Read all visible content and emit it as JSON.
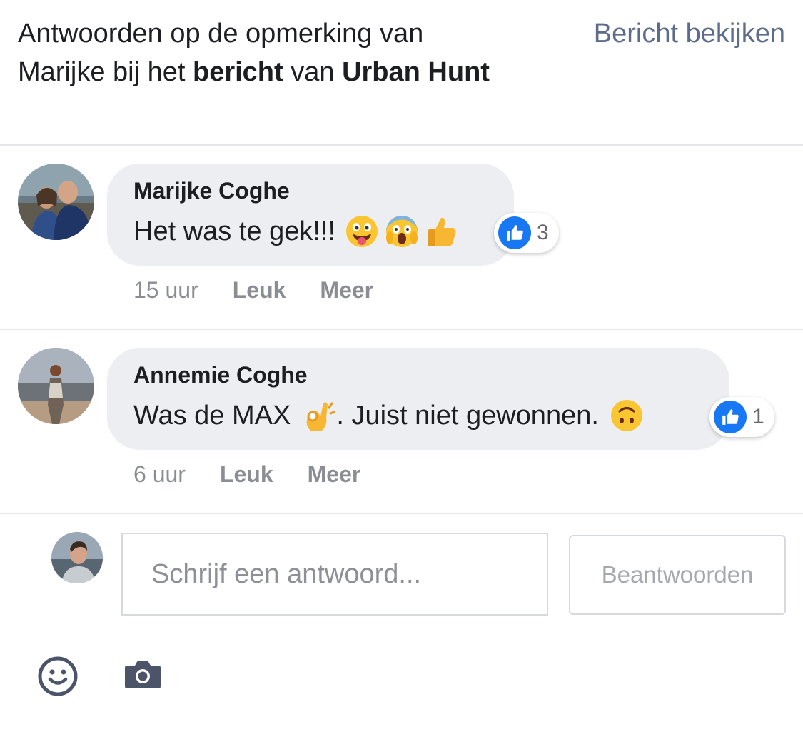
{
  "header": {
    "title_part1": "Antwoorden op de opmerking van Marijke bij het ",
    "title_bold1": "bericht",
    "title_part2": " van ",
    "title_bold2": "Urban Hunt",
    "view_post_label": "Bericht bekijken"
  },
  "comments": [
    {
      "author": "Marijke Coghe",
      "text": "Het was te gek!!!",
      "emojis": [
        "grinning-tongue-emoji",
        "screaming-face-emoji",
        "thumbs-up-emoji"
      ],
      "reaction_count": "3",
      "time": "15 uur",
      "like_label": "Leuk",
      "more_label": "Meer"
    },
    {
      "author": "Annemie Coghe",
      "text_before": "Was de MAX",
      "text_after": ". Juist niet gewonnen.",
      "emojis": [
        "ok-hand-emoji",
        "upside-down-face-emoji"
      ],
      "reaction_count": "1",
      "time": "6 uur",
      "like_label": "Leuk",
      "more_label": "Meer"
    }
  ],
  "composer": {
    "placeholder": "Schrijf een antwoord...",
    "value": "",
    "submit_label": "Beantwoorden",
    "tools": [
      "smiley-icon",
      "camera-icon"
    ]
  },
  "colors": {
    "link": "#5d6c8c",
    "bubble": "#eceef1",
    "like_blue": "#1877f2",
    "muted": "#8a8d91"
  }
}
